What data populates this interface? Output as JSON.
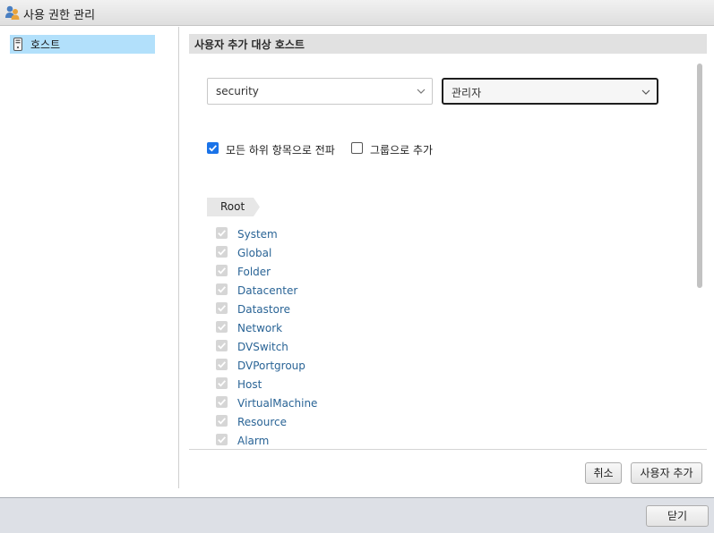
{
  "window": {
    "title": "사용 권한 관리",
    "icon": "users-icon"
  },
  "sidebar": {
    "items": [
      {
        "label": "호스트",
        "icon": "host-icon",
        "selected": true
      }
    ]
  },
  "main": {
    "section_title": "사용자 추가 대상 호스트",
    "user_select": {
      "value": "security"
    },
    "role_select": {
      "value": "관리자"
    },
    "options": {
      "propagate": {
        "label": "모든 하위 항목으로 전파",
        "checked": true
      },
      "add_as_group": {
        "label": "그룹으로 추가",
        "checked": false
      }
    },
    "breadcrumb": {
      "label": "Root"
    },
    "privileges": [
      {
        "label": "System",
        "checked": true
      },
      {
        "label": "Global",
        "checked": true
      },
      {
        "label": "Folder",
        "checked": true
      },
      {
        "label": "Datacenter",
        "checked": true
      },
      {
        "label": "Datastore",
        "checked": true
      },
      {
        "label": "Network",
        "checked": true
      },
      {
        "label": "DVSwitch",
        "checked": true
      },
      {
        "label": "DVPortgroup",
        "checked": true
      },
      {
        "label": "Host",
        "checked": true
      },
      {
        "label": "VirtualMachine",
        "checked": true
      },
      {
        "label": "Resource",
        "checked": true
      },
      {
        "label": "Alarm",
        "checked": true
      }
    ],
    "cancel_label": "취소",
    "add_user_label": "사용자 추가"
  },
  "footer": {
    "close_label": "닫기"
  },
  "colors": {
    "accent": "#1a73e8",
    "selection": "#b2e0fb",
    "link": "#2a6496"
  }
}
